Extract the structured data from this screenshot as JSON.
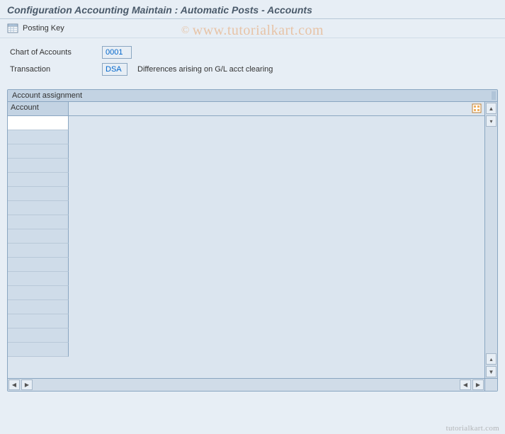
{
  "title": "Configuration Accounting Maintain : Automatic Posts - Accounts",
  "toolbar": {
    "posting_key_label": "Posting Key"
  },
  "form": {
    "chart_of_accounts_label": "Chart of Accounts",
    "chart_of_accounts_value": "0001",
    "transaction_label": "Transaction",
    "transaction_value": "DSA",
    "transaction_desc": "Differences arising on G/L acct clearing"
  },
  "panel": {
    "title": "Account assignment",
    "column_header": "Account",
    "rows": [
      "",
      "",
      "",
      "",
      "",
      "",
      "",
      "",
      "",
      "",
      "",
      "",
      "",
      "",
      "",
      "",
      ""
    ]
  },
  "watermark": {
    "main": "www.tutorialkart.com",
    "copyright": "©",
    "bottom": "tutorialkart.com"
  }
}
